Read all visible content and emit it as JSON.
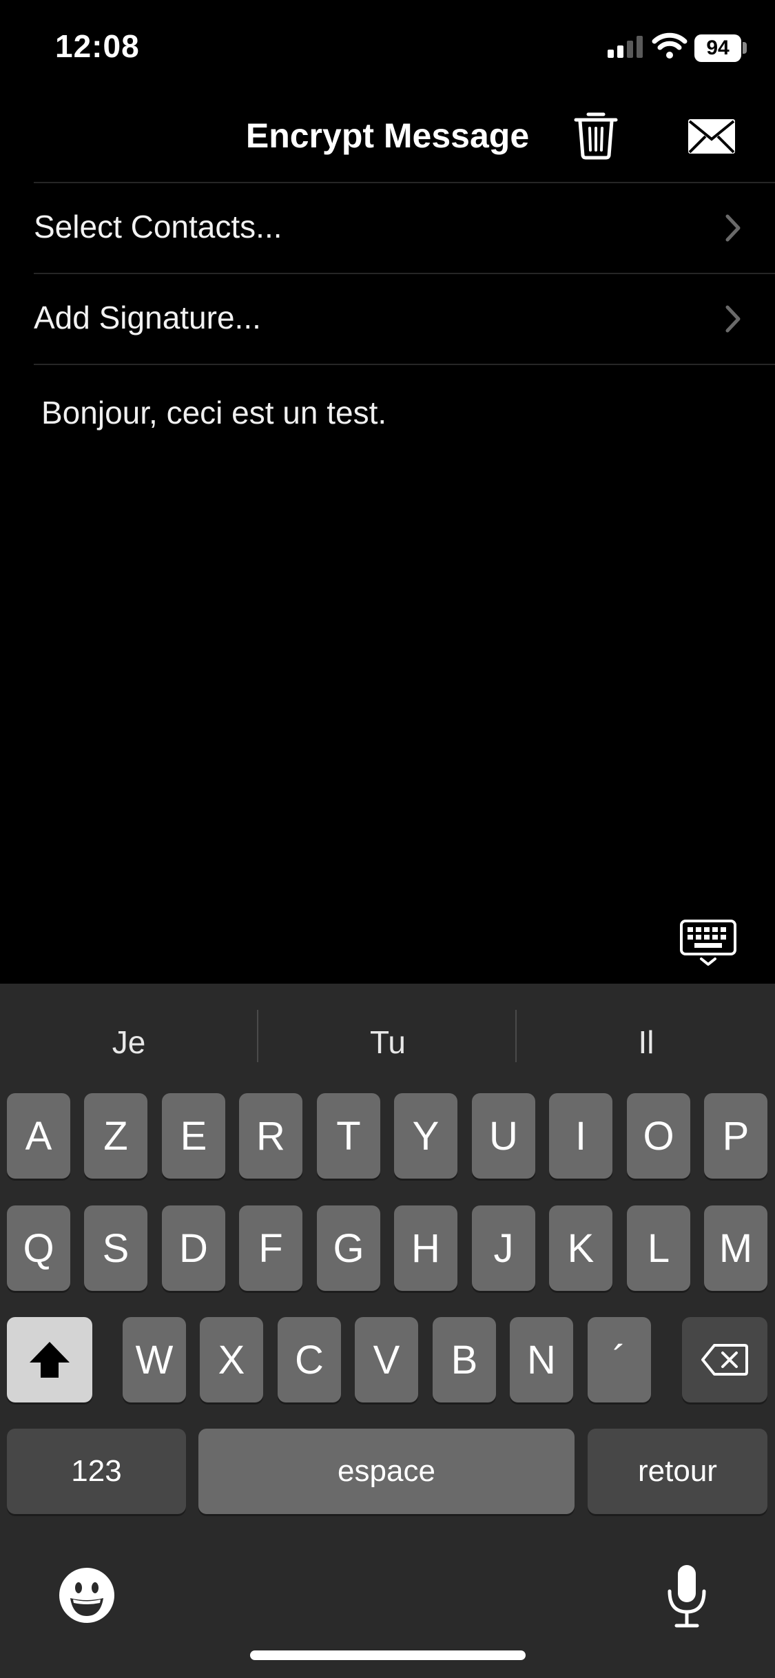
{
  "status_bar": {
    "time": "12:08",
    "battery": "94"
  },
  "nav": {
    "title": "Encrypt Message",
    "trash_icon": "trash-icon",
    "mail_icon": "envelope-icon"
  },
  "rows": [
    {
      "label": "Select Contacts..."
    },
    {
      "label": "Add Signature..."
    }
  ],
  "message": {
    "text": "Bonjour, ceci est un test."
  },
  "keyboard": {
    "suggestions": [
      "Je",
      "Tu",
      "Il"
    ],
    "row1": [
      "A",
      "Z",
      "E",
      "R",
      "T",
      "Y",
      "U",
      "I",
      "O",
      "P"
    ],
    "row2": [
      "Q",
      "S",
      "D",
      "F",
      "G",
      "H",
      "J",
      "K",
      "L",
      "M"
    ],
    "row3": [
      "W",
      "X",
      "C",
      "V",
      "B",
      "N",
      "´"
    ],
    "numbers_label": "123",
    "space_label": "espace",
    "return_label": "retour"
  }
}
